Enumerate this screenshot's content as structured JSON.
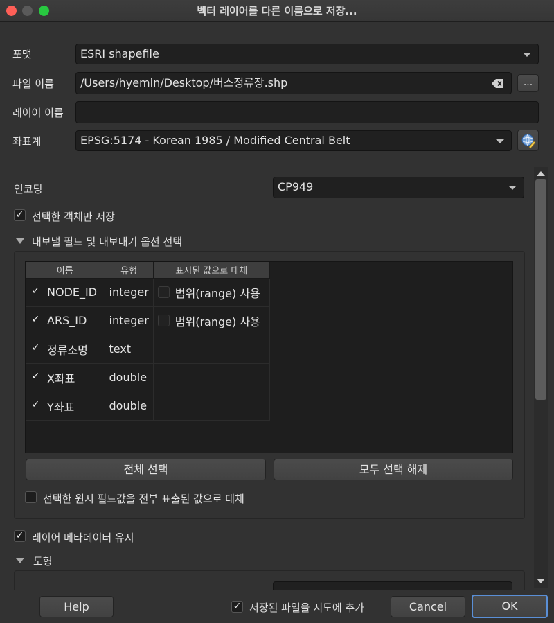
{
  "window": {
    "title": "벡터 레이어를 다른 이름으로 저장..."
  },
  "form": {
    "format_label": "포맷",
    "format_value": "ESRI shapefile",
    "filename_label": "파일 이름",
    "filename_value": "/Users/hyemin/Desktop/버스정류장.shp",
    "browse_label": "...",
    "layername_label": "레이어 이름",
    "layername_value": "",
    "crs_label": "좌표계",
    "crs_value": "EPSG:5174 - Korean 1985 / Modified Central Belt"
  },
  "options": {
    "encoding_label": "인코딩",
    "encoding_value": "CP949",
    "selected_only_label": "선택한 객체만 저장",
    "export_fields_label": "내보낼 필드 및 내보내기 옵션 선택",
    "fields_table": {
      "headers": [
        "이름",
        "유형",
        "표시된 값으로 대체"
      ],
      "rows": [
        {
          "checked": true,
          "name": "NODE_ID",
          "type": "integer",
          "replace": "범위(range) 사용",
          "has_replace": true
        },
        {
          "checked": true,
          "name": "ARS_ID",
          "type": "integer",
          "replace": "범위(range) 사용",
          "has_replace": true
        },
        {
          "checked": true,
          "name": "정류소명",
          "type": "text",
          "replace": "",
          "has_replace": false
        },
        {
          "checked": true,
          "name": "X좌표",
          "type": "double",
          "replace": "",
          "has_replace": false
        },
        {
          "checked": true,
          "name": "Y좌표",
          "type": "double",
          "replace": "",
          "has_replace": false
        }
      ]
    },
    "select_all_label": "전체 선택",
    "deselect_all_label": "모두 선택 해제",
    "replace_all_label": "선택한 원시 필드값을 전부 표출된 값으로 대체",
    "keep_metadata_label": "레이어 메타데이터 유지",
    "geometry_label": "도형"
  },
  "footer": {
    "help_label": "Help",
    "add_to_map_label": "저장된 파일을 지도에 추가",
    "cancel_label": "Cancel",
    "ok_label": "OK"
  },
  "check": "✓",
  "colors": {
    "close": "#ff5f57",
    "minimize": "#5a5a5a",
    "zoom": "#28c840",
    "ok_border": "#5a8fd6"
  },
  "icons": {
    "clear": "clear-text-icon",
    "crs": "crs-globe-icon"
  }
}
